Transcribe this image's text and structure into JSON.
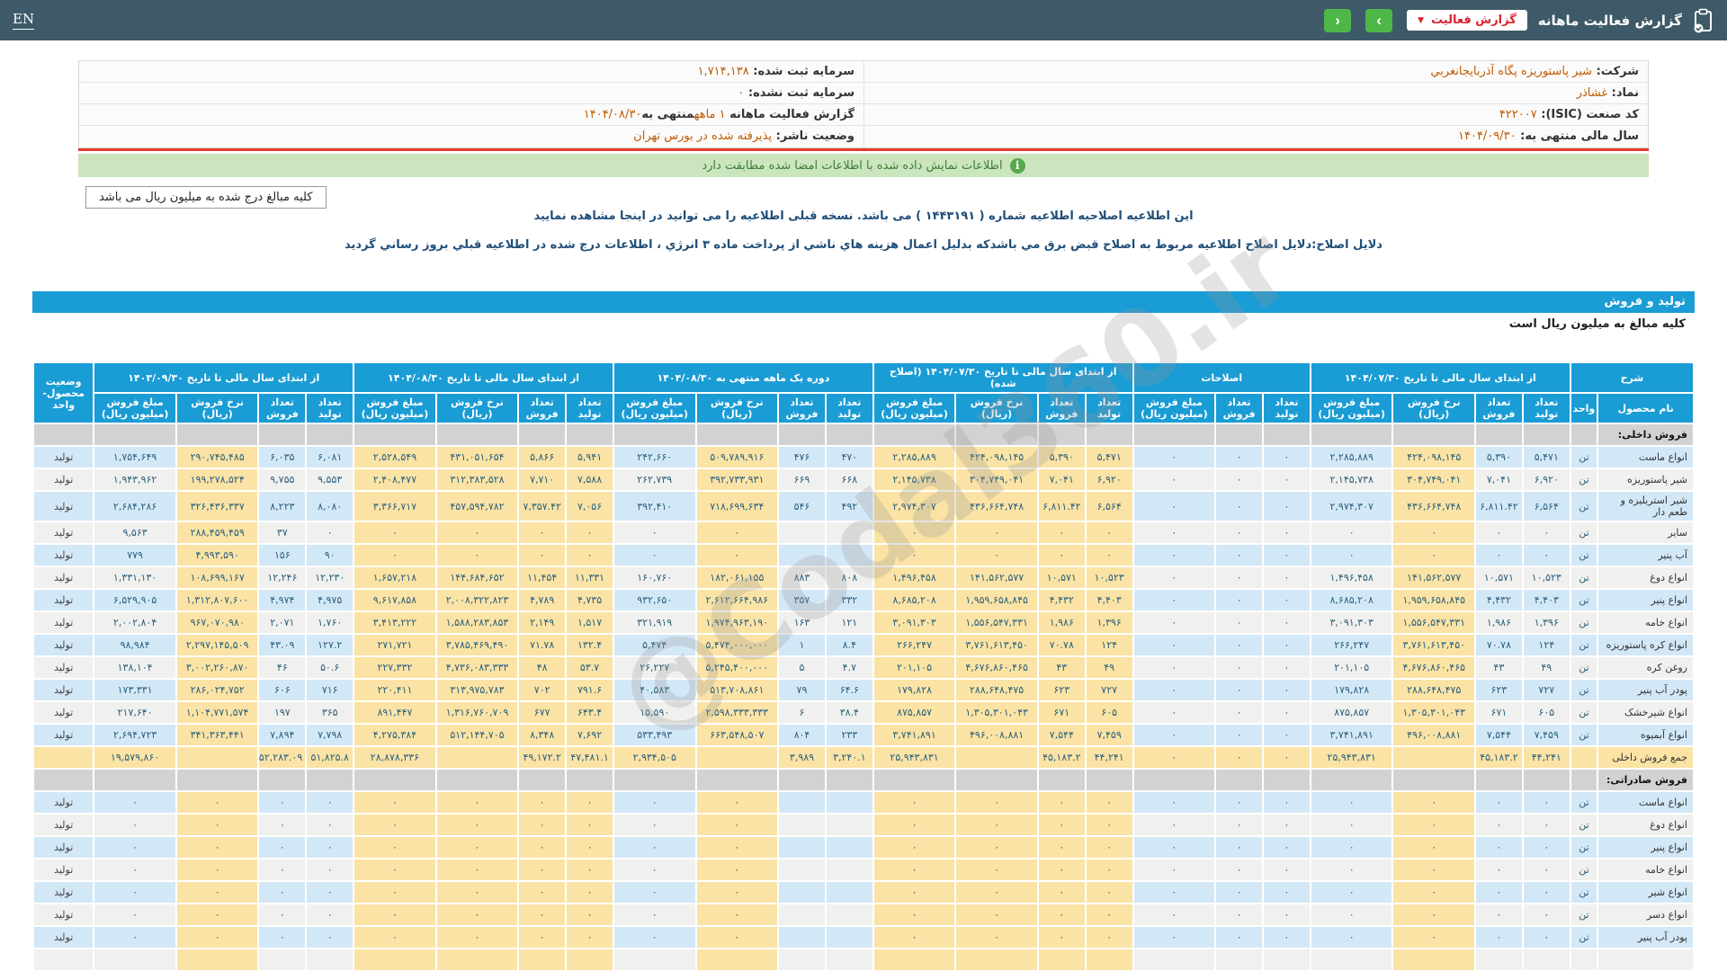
{
  "topbar": {
    "title": "گزارش فعالیت ماهانه",
    "dropdown_label": "گزارش فعالیت",
    "lang": "EN",
    "prev_icon": "‹",
    "next_icon": "›",
    "colors": {
      "bar": "#3E5A68",
      "button_green": "#4FB748",
      "accent_red": "#D9232E"
    }
  },
  "company": {
    "rows": [
      {
        "label": "شرکت:",
        "value": "شیر پاستوریزه پگاه آذربایجانغربي"
      },
      {
        "label": "سرمایه ثبت شده:",
        "value": "۱,۷۱۴,۱۳۸"
      },
      {
        "label": "نماد:",
        "value": "غشاذر"
      },
      {
        "label": "سرمایه ثبت نشده:",
        "value": "۰"
      },
      {
        "label": "کد صنعت (ISIC):",
        "value": "۴۲۲۰۰۷"
      },
      {
        "label": "گزارش فعالیت ماهانه",
        "parts": [
          {
            "t": "۱ ماهه",
            "hl": true
          },
          {
            "t": "منتهی به",
            "hl": false
          },
          {
            "t": "۱۴۰۴/۰۸/۳۰",
            "hl": true
          }
        ]
      },
      {
        "label": "سال مالی منتهی به:",
        "value": "۱۴۰۴/۰۹/۳۰"
      },
      {
        "label": "وضعیت ناشر:",
        "value": "پذیرفته شده در بورس تهران"
      }
    ]
  },
  "banner": {
    "text": "اطلاعات نمایش داده شده با اطلاعات امضا شده مطابقت دارد",
    "icon": "i"
  },
  "notes": {
    "line1": "این اطلاعیه اصلاحیه اطلاعیه شماره ( ۱۴۴۳۱۹۱ ) می باشد. نسخه قبلی اطلاعیه را می توانید در اینجا مشاهده نمایید",
    "line2": "دلایل اصلاح:دلایل اصلاح اطلاعیه مربوط به اصلاح قبض برق مي باشدکه بدلیل اعمال هزینه هاي ناشي از پرداخت ماده ۳ انرژي ، اطلاعات درج شده در اطلاعیه قبلي بروز رساني گردید"
  },
  "section": {
    "amounts_note": "کلیه مبالغ درج شده به میلیون ریال می باشد",
    "title": "تولید و فروش",
    "subtitle": "کلیه مبالغ به میلیون ریال است",
    "header_blue": "#1A9CD5"
  },
  "watermark": "@Codal360.ir",
  "table": {
    "header": {
      "sherh": "شرح",
      "name": "نام محصول",
      "unit": "واحد",
      "status": "وضعیت محصول-واحد",
      "groups": [
        {
          "title": "از ابتدای سال مالی تا تاریخ ۱۴۰۴/۰۷/۳۰",
          "hl": false,
          "cols": [
            "تعداد تولید",
            "تعداد فروش",
            "نرخ فروش (ریال)",
            "مبلغ فروش (میلیون ریال)"
          ]
        },
        {
          "title": "اصلاحات",
          "hl": false,
          "cols": [
            "تعداد تولید",
            "تعداد فروش",
            "مبلغ فروش (میلیون ریال)"
          ]
        },
        {
          "title": "از ابتدای سال مالی تا تاریخ ۱۴۰۴/۰۷/۳۰ (اصلاح شده)",
          "hl": true,
          "cols": [
            "تعداد تولید",
            "تعداد فروش",
            "نرخ فروش (ریال)",
            "مبلغ فروش (میلیون ریال)"
          ]
        },
        {
          "title": "دوره یک ماهه منتهی به ۱۴۰۴/۰۸/۳۰",
          "hl": false,
          "cols": [
            "تعداد تولید",
            "تعداد فروش",
            "نرخ فروش (ریال)",
            "مبلغ فروش (میلیون ریال)"
          ]
        },
        {
          "title": "از ابتدای سال مالی تا تاریخ ۱۴۰۴/۰۸/۳۰",
          "hl": true,
          "cols": [
            "تعداد تولید",
            "تعداد فروش",
            "نرخ فروش (ریال)",
            "مبلغ فروش (میلیون ریال)"
          ]
        },
        {
          "title": "از ابتدای سال مالی تا تاریخ ۱۴۰۳/۰۹/۳۰",
          "hl": false,
          "cols": [
            "تعداد تولید",
            "تعداد فروش",
            "نرخ فروش (ریال)",
            "مبلغ فروش (میلیون ریال)"
          ]
        }
      ]
    },
    "rows": [
      {
        "type": "group",
        "name": "فروش داخلی:"
      },
      {
        "type": "item",
        "name": "انواع ماست",
        "unit": "تن",
        "status": "تولید",
        "cells": [
          "۵,۴۷۱",
          "۵,۳۹۰",
          "۴۲۴,۰۹۸,۱۴۵",
          "۲,۲۸۵,۸۸۹",
          "۰",
          "۰",
          "۰",
          "۵,۴۷۱",
          "۵,۳۹۰",
          "۴۲۴,۰۹۸,۱۴۵",
          "۲,۲۸۵,۸۸۹",
          "۴۷۰",
          "۴۷۶",
          "۵۰۹,۷۸۹,۹۱۶",
          "۲۴۲,۶۶۰",
          "۵,۹۴۱",
          "۵,۸۶۶",
          "۴۳۱,۰۵۱,۶۵۴",
          "۲,۵۲۸,۵۴۹",
          "۶,۰۸۱",
          "۶,۰۳۵",
          "۲۹۰,۷۴۵,۴۸۵",
          "۱,۷۵۴,۶۴۹"
        ]
      },
      {
        "type": "item",
        "name": "شیر پاستوریزه",
        "unit": "تن",
        "status": "تولید",
        "cells": [
          "۶,۹۲۰",
          "۷,۰۴۱",
          "۳۰۴,۷۴۹,۰۴۱",
          "۲,۱۴۵,۷۳۸",
          "۰",
          "۰",
          "۰",
          "۶,۹۲۰",
          "۷,۰۴۱",
          "۳۰۴,۷۴۹,۰۴۱",
          "۲,۱۴۵,۷۳۸",
          "۶۶۸",
          "۶۶۹",
          "۳۹۲,۷۳۳,۹۳۱",
          "۲۶۲,۷۳۹",
          "۷,۵۸۸",
          "۷,۷۱۰",
          "۳۱۲,۳۸۳,۵۲۸",
          "۲,۴۰۸,۴۷۷",
          "۹,۵۵۳",
          "۹,۷۵۵",
          "۱۹۹,۲۷۸,۵۲۴",
          "۱,۹۴۳,۹۶۲"
        ]
      },
      {
        "type": "item",
        "name": "شیر استریلیزه و طعم دار",
        "unit": "تن",
        "status": "تولید",
        "cells": [
          "۶,۵۶۴",
          "۶,۸۱۱.۴۲",
          "۴۳۶,۶۶۴,۷۴۸",
          "۲,۹۷۴,۳۰۷",
          "۰",
          "۰",
          "۰",
          "۶,۵۶۴",
          "۶,۸۱۱.۴۲",
          "۴۳۶,۶۶۴,۷۴۸",
          "۲,۹۷۴,۳۰۷",
          "۴۹۲",
          "۵۴۶",
          "۷۱۸,۶۹۹,۶۳۴",
          "۳۹۲,۴۱۰",
          "۷,۰۵۶",
          "۷,۳۵۷.۴۲",
          "۴۵۷,۵۹۴,۷۸۲",
          "۳,۳۶۶,۷۱۷",
          "۸,۰۸۰",
          "۸,۲۲۳",
          "۳۲۶,۴۳۶,۳۳۷",
          "۲,۶۸۴,۲۸۶"
        ]
      },
      {
        "type": "item",
        "name": "سایر",
        "unit": "تن",
        "status": "تولید",
        "cells": [
          "۰",
          "۰",
          "۰",
          "۰",
          "۰",
          "۰",
          "۰",
          "۰",
          "۰",
          "۰",
          "۰",
          "",
          "",
          "۰",
          "۰",
          "۰",
          "۰",
          "۰",
          "۰",
          "۰",
          "۳۷",
          "۲۸۸,۴۵۹,۴۵۹",
          "۹,۵۶۳"
        ]
      },
      {
        "type": "item",
        "name": "آب پنیر",
        "unit": "تن",
        "status": "تولید",
        "cells": [
          "۰",
          "۰",
          "۰",
          "۰",
          "۰",
          "۰",
          "۰",
          "۰",
          "۰",
          "۰",
          "۰",
          "",
          "",
          "۰",
          "۰",
          "۰",
          "۰",
          "۰",
          "۰",
          "۹۰",
          "۱۵۶",
          "۴,۹۹۳,۵۹۰",
          "۷۷۹"
        ]
      },
      {
        "type": "item",
        "name": "انواع دوغ",
        "unit": "تن",
        "status": "تولید",
        "cells": [
          "۱۰,۵۲۳",
          "۱۰,۵۷۱",
          "۱۴۱,۵۶۲,۵۷۷",
          "۱,۴۹۶,۴۵۸",
          "۰",
          "۰",
          "۰",
          "۱۰,۵۲۳",
          "۱۰,۵۷۱",
          "۱۴۱,۵۶۲,۵۷۷",
          "۱,۴۹۶,۴۵۸",
          "۸۰۸",
          "۸۸۳",
          "۱۸۲,۰۶۱,۱۵۵",
          "۱۶۰,۷۶۰",
          "۱۱,۳۳۱",
          "۱۱,۴۵۴",
          "۱۴۴,۶۸۴,۶۵۲",
          "۱,۶۵۷,۲۱۸",
          "۱۲,۲۳۰",
          "۱۲,۲۴۶",
          "۱۰۸,۶۹۹,۱۶۷",
          "۱,۳۳۱,۱۳۰"
        ]
      },
      {
        "type": "item",
        "name": "انواع پنیر",
        "unit": "تن",
        "status": "تولید",
        "cells": [
          "۴,۴۰۳",
          "۴,۴۳۲",
          "۱,۹۵۹,۶۵۸,۸۴۵",
          "۸,۶۸۵,۲۰۸",
          "۰",
          "۰",
          "۰",
          "۴,۴۰۳",
          "۴,۴۳۲",
          "۱,۹۵۹,۶۵۸,۸۴۵",
          "۸,۶۸۵,۲۰۸",
          "۳۳۲",
          "۳۵۷",
          "۲,۶۱۲,۶۶۴,۹۸۶",
          "۹۳۲,۶۵۰",
          "۴,۷۳۵",
          "۴,۷۸۹",
          "۲,۰۰۸,۳۲۲,۸۲۳",
          "۹,۶۱۷,۸۵۸",
          "۴,۹۷۵",
          "۴,۹۷۴",
          "۱,۳۱۲,۸۰۷,۶۰۰",
          "۶,۵۲۹,۹۰۵"
        ]
      },
      {
        "type": "item",
        "name": "انواع خامه",
        "unit": "تن",
        "status": "تولید",
        "cells": [
          "۱,۳۹۶",
          "۱,۹۸۶",
          "۱,۵۵۶,۵۴۷,۳۳۱",
          "۳,۰۹۱,۳۰۳",
          "۰",
          "۰",
          "۰",
          "۱,۳۹۶",
          "۱,۹۸۶",
          "۱,۵۵۶,۵۴۷,۳۳۱",
          "۳,۰۹۱,۳۰۳",
          "۱۲۱",
          "۱۶۳",
          "۱,۹۷۴,۹۶۳,۱۹۰",
          "۳۲۱,۹۱۹",
          "۱,۵۱۷",
          "۲,۱۴۹",
          "۱,۵۸۸,۲۸۳,۸۵۳",
          "۳,۴۱۳,۲۲۲",
          "۱,۷۶۰",
          "۲,۰۷۱",
          "۹۶۷,۰۷۰,۹۸۰",
          "۲,۰۰۲,۸۰۴"
        ]
      },
      {
        "type": "item",
        "name": "انواع کره پاستوریزه",
        "unit": "تن",
        "status": "تولید",
        "cells": [
          "۱۲۴",
          "۷۰.۷۸",
          "۳,۷۶۱,۶۱۳,۴۵۰",
          "۲۶۶,۲۴۷",
          "۰",
          "۰",
          "۰",
          "۱۲۴",
          "۷۰.۷۸",
          "۳,۷۶۱,۶۱۳,۴۵۰",
          "۲۶۶,۲۴۷",
          "۸.۴",
          "۱",
          "۵,۴۷۴,۰۰۰,۰۰۰",
          "۵,۴۷۴",
          "۱۳۲.۴",
          "۷۱.۷۸",
          "۳,۷۸۵,۴۶۹,۴۹۰",
          "۲۷۱,۷۲۱",
          "۱۲۷.۲",
          "۴۳.۰۹",
          "۲,۲۹۷,۱۴۵,۵۰۹",
          "۹۸,۹۸۴"
        ]
      },
      {
        "type": "item",
        "name": "روغن کره",
        "unit": "تن",
        "status": "تولید",
        "cells": [
          "۴۹",
          "۴۳",
          "۴,۶۷۶,۸۶۰,۴۶۵",
          "۲۰۱,۱۰۵",
          "۰",
          "۰",
          "۰",
          "۴۹",
          "۴۳",
          "۴,۶۷۶,۸۶۰,۴۶۵",
          "۲۰۱,۱۰۵",
          "۴.۷",
          "۵",
          "۵,۲۴۵,۴۰۰,۰۰۰",
          "۲۶,۲۲۷",
          "۵۳.۷",
          "۴۸",
          "۴,۷۳۶,۰۸۳,۳۳۳",
          "۲۲۷,۳۳۲",
          "۵۰.۶",
          "۴۶",
          "۳,۰۰۲,۲۶۰,۸۷۰",
          "۱۳۸,۱۰۴"
        ]
      },
      {
        "type": "item",
        "name": "پودر آب پنیر",
        "unit": "تن",
        "status": "تولید",
        "cells": [
          "۷۲۷",
          "۶۲۳",
          "۲۸۸,۶۴۸,۴۷۵",
          "۱۷۹,۸۲۸",
          "۰",
          "۰",
          "۰",
          "۷۲۷",
          "۶۲۳",
          "۲۸۸,۶۴۸,۴۷۵",
          "۱۷۹,۸۲۸",
          "۶۴.۶",
          "۷۹",
          "۵۱۳,۷۰۸,۸۶۱",
          "۴۰,۵۸۳",
          "۷۹۱.۶",
          "۷۰۲",
          "۳۱۳,۹۷۵,۷۸۳",
          "۲۲۰,۴۱۱",
          "۷۱۶",
          "۶۰۶",
          "۲۸۶,۰۲۴,۷۵۲",
          "۱۷۳,۳۳۱"
        ]
      },
      {
        "type": "item",
        "name": "انواع شیرخشک",
        "unit": "تن",
        "status": "تولید",
        "cells": [
          "۶۰۵",
          "۶۷۱",
          "۱,۳۰۵,۳۰۱,۰۴۳",
          "۸۷۵,۸۵۷",
          "۰",
          "۰",
          "۰",
          "۶۰۵",
          "۶۷۱",
          "۱,۳۰۵,۳۰۱,۰۴۳",
          "۸۷۵,۸۵۷",
          "۳۸.۴",
          "۶",
          "۲,۵۹۸,۳۳۳,۳۳۳",
          "۱۵,۵۹۰",
          "۶۴۳.۴",
          "۶۷۷",
          "۱,۳۱۶,۷۶۰,۷۰۹",
          "۸۹۱,۴۴۷",
          "۳۶۵",
          "۱۹۷",
          "۱,۱۰۴,۷۷۱,۵۷۴",
          "۲۱۷,۶۴۰"
        ]
      },
      {
        "type": "item",
        "name": "انواع آبمیوه",
        "unit": "تن",
        "status": "تولید",
        "cells": [
          "۷,۴۵۹",
          "۷,۵۴۴",
          "۴۹۶,۰۰۸,۸۸۱",
          "۳,۷۴۱,۸۹۱",
          "۰",
          "۰",
          "۰",
          "۷,۴۵۹",
          "۷,۵۴۴",
          "۴۹۶,۰۰۸,۸۸۱",
          "۳,۷۴۱,۸۹۱",
          "۲۳۳",
          "۸۰۴",
          "۶۶۳,۵۴۸,۵۰۷",
          "۵۳۳,۴۹۳",
          "۷,۶۹۲",
          "۸,۳۴۸",
          "۵۱۲,۱۴۴,۷۰۵",
          "۴,۲۷۵,۳۸۴",
          "۷,۷۹۸",
          "۷,۸۹۴",
          "۳۴۱,۳۶۳,۴۴۱",
          "۲,۶۹۴,۷۲۳"
        ]
      },
      {
        "type": "total",
        "name": "جمع فروش داخلی",
        "unit": "",
        "status": "",
        "cells": [
          "۴۴,۲۴۱",
          "۴۵,۱۸۳.۲",
          "",
          "۲۵,۹۴۳,۸۳۱",
          "۰",
          "۰",
          "۰",
          "۴۴,۲۴۱",
          "۴۵,۱۸۳.۲",
          "",
          "۲۵,۹۴۳,۸۳۱",
          "۳,۲۴۰.۱",
          "۳,۹۸۹",
          "",
          "۲,۹۳۴,۵۰۵",
          "۴۷,۴۸۱.۱",
          "۴۹,۱۷۲.۲",
          "",
          "۲۸,۸۷۸,۳۳۶",
          "۵۱,۸۲۵.۸",
          "۵۲,۲۸۳.۰۹",
          "",
          "۱۹,۵۷۹,۸۶۰"
        ]
      },
      {
        "type": "group",
        "name": "فروش صادراتی:"
      },
      {
        "type": "item",
        "name": "انواع ماست",
        "unit": "تن",
        "status": "تولید",
        "cells": [
          "۰",
          "۰",
          "۰",
          "۰",
          "۰",
          "۰",
          "۰",
          "۰",
          "۰",
          "۰",
          "۰",
          "",
          "",
          "۰",
          "۰",
          "۰",
          "۰",
          "۰",
          "۰",
          "۰",
          "۰",
          "۰",
          "۰"
        ]
      },
      {
        "type": "item",
        "name": "انواع دوغ",
        "unit": "تن",
        "status": "تولید",
        "cells": [
          "۰",
          "۰",
          "۰",
          "۰",
          "۰",
          "۰",
          "۰",
          "۰",
          "۰",
          "۰",
          "۰",
          "",
          "",
          "۰",
          "۰",
          "۰",
          "۰",
          "۰",
          "۰",
          "۰",
          "۰",
          "۰",
          "۰"
        ]
      },
      {
        "type": "item",
        "name": "انواع پنیر",
        "unit": "تن",
        "status": "تولید",
        "cells": [
          "۰",
          "۰",
          "۰",
          "۰",
          "۰",
          "۰",
          "۰",
          "۰",
          "۰",
          "۰",
          "۰",
          "",
          "",
          "۰",
          "۰",
          "۰",
          "۰",
          "۰",
          "۰",
          "۰",
          "۰",
          "۰",
          "۰"
        ]
      },
      {
        "type": "item",
        "name": "انواع خامه",
        "unit": "تن",
        "status": "تولید",
        "cells": [
          "۰",
          "۰",
          "۰",
          "۰",
          "۰",
          "۰",
          "۰",
          "۰",
          "۰",
          "۰",
          "۰",
          "",
          "",
          "۰",
          "۰",
          "۰",
          "۰",
          "۰",
          "۰",
          "۰",
          "۰",
          "۰",
          "۰"
        ]
      },
      {
        "type": "item",
        "name": "انواع شیر",
        "unit": "تن",
        "status": "تولید",
        "cells": [
          "۰",
          "۰",
          "۰",
          "۰",
          "۰",
          "۰",
          "۰",
          "۰",
          "۰",
          "۰",
          "۰",
          "",
          "",
          "۰",
          "۰",
          "۰",
          "۰",
          "۰",
          "۰",
          "۰",
          "۰",
          "۰",
          "۰"
        ]
      },
      {
        "type": "item",
        "name": "انواع دسر",
        "unit": "تن",
        "status": "تولید",
        "cells": [
          "۰",
          "۰",
          "۰",
          "۰",
          "۰",
          "۰",
          "۰",
          "۰",
          "۰",
          "۰",
          "۰",
          "",
          "",
          "۰",
          "۰",
          "۰",
          "۰",
          "۰",
          "۰",
          "۰",
          "۰",
          "۰",
          "۰"
        ]
      },
      {
        "type": "item",
        "name": "پودر آب پنیر",
        "unit": "تن",
        "status": "تولید",
        "cells": [
          "۰",
          "۰",
          "۰",
          "۰",
          "۰",
          "۰",
          "۰",
          "۰",
          "۰",
          "۰",
          "۰",
          "",
          "",
          "۰",
          "۰",
          "۰",
          "۰",
          "۰",
          "۰",
          "۰",
          "۰",
          "۰",
          "۰"
        ]
      },
      {
        "type": "item",
        "name": "",
        "unit": "",
        "status": "",
        "cells": [
          "",
          "",
          "",
          "",
          "",
          "",
          "",
          "",
          "",
          "",
          "",
          "",
          "",
          "",
          "",
          "",
          "",
          "",
          "",
          "",
          "",
          "",
          ""
        ]
      }
    ]
  }
}
